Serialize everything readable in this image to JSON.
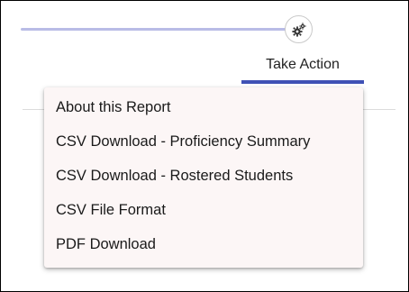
{
  "toolbar": {
    "slider_icon": "slider-track",
    "settings_icon": "gears-icon",
    "accent_color": "#3f51b5",
    "track_color": "#b9bce6"
  },
  "tab": {
    "label": "Take Action"
  },
  "menu": {
    "background": "#fcf6f6",
    "items": [
      {
        "label": "About this Report"
      },
      {
        "label": "CSV Download - Proficiency Summary"
      },
      {
        "label": "CSV Download - Rostered Students"
      },
      {
        "label": "CSV File Format"
      },
      {
        "label": "PDF Download"
      }
    ]
  }
}
